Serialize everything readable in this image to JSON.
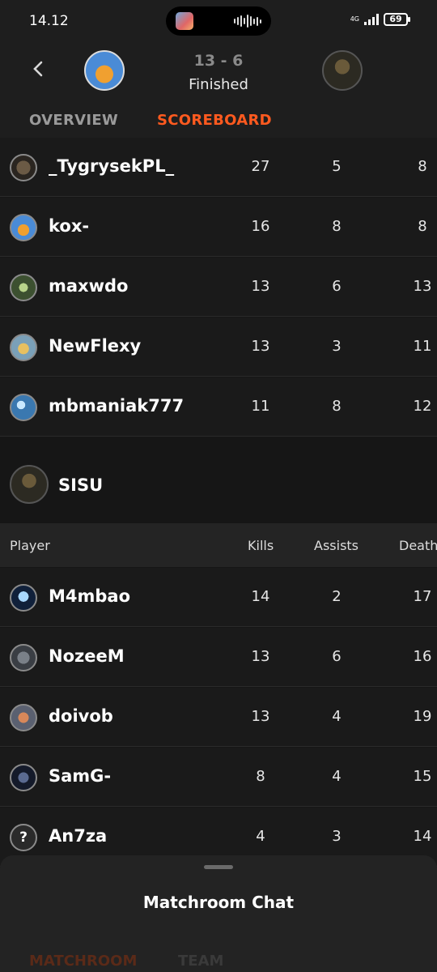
{
  "status_bar": {
    "time": "14.12",
    "network": "4G",
    "battery": "69"
  },
  "match": {
    "score": "13 - 6",
    "status": "Finished"
  },
  "tabs": {
    "overview": "OVERVIEW",
    "scoreboard": "SCOREBOARD"
  },
  "team1": {
    "players": [
      {
        "name": "_TygrysekPL_",
        "kills": "27",
        "assists": "5",
        "deaths": "8"
      },
      {
        "name": "kox-",
        "kills": "16",
        "assists": "8",
        "deaths": "8"
      },
      {
        "name": "maxwdo",
        "kills": "13",
        "assists": "6",
        "deaths": "13"
      },
      {
        "name": "NewFlexy",
        "kills": "13",
        "assists": "3",
        "deaths": "11"
      },
      {
        "name": "mbmaniak777",
        "kills": "11",
        "assists": "8",
        "deaths": "12"
      }
    ]
  },
  "team2": {
    "name": "SISU",
    "columns": {
      "player": "Player",
      "kills": "Kills",
      "assists": "Assists",
      "deaths": "Death"
    },
    "players": [
      {
        "name": "M4mbao",
        "kills": "14",
        "assists": "2",
        "deaths": "17"
      },
      {
        "name": "NozeeM",
        "kills": "13",
        "assists": "6",
        "deaths": "16"
      },
      {
        "name": "doivob",
        "kills": "13",
        "assists": "4",
        "deaths": "19"
      },
      {
        "name": "SamG-",
        "kills": "8",
        "assists": "4",
        "deaths": "15"
      },
      {
        "name": "An7za",
        "kills": "4",
        "assists": "3",
        "deaths": "14",
        "avatar_glyph": "?"
      }
    ]
  },
  "chat_sheet": {
    "title": "Matchroom Chat",
    "tab_matchroom": "MATCHROOM",
    "tab_team": "TEAM"
  },
  "colors": {
    "accent": "#ff5a1f",
    "background": "#161616",
    "row": "#1a1a1a"
  },
  "icons": {
    "back": "chevron-left-icon",
    "unknown_avatar": "question-mark-icon"
  }
}
